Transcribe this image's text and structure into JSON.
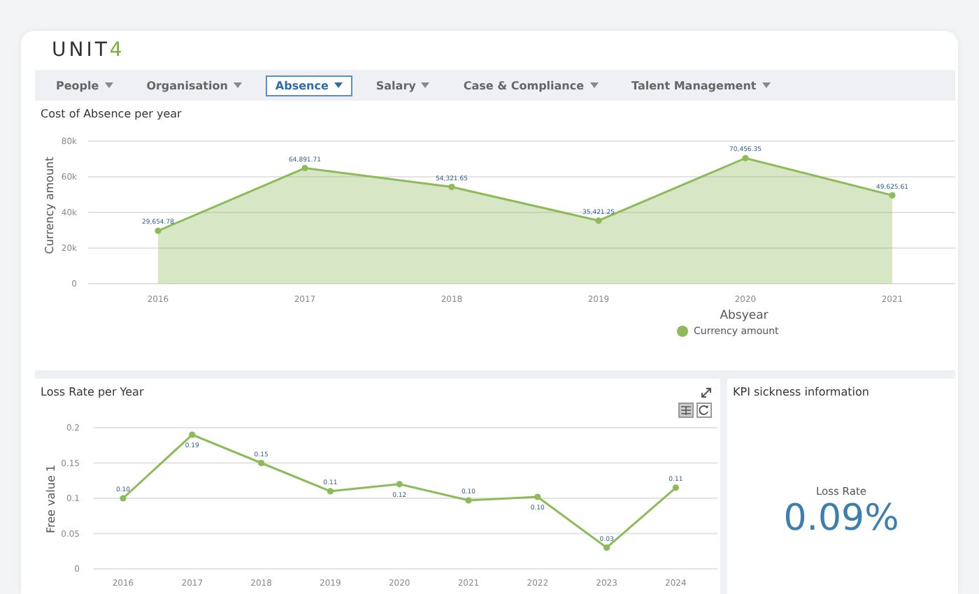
{
  "logo": {
    "text": "UNIT",
    "accent": "4"
  },
  "nav": [
    {
      "label": "People",
      "selected": false
    },
    {
      "label": "Organisation",
      "selected": false
    },
    {
      "label": "Absence",
      "selected": true
    },
    {
      "label": "Salary",
      "selected": false
    },
    {
      "label": "Case & Compliance",
      "selected": false
    },
    {
      "label": "Talent Management",
      "selected": false
    }
  ],
  "cost_panel": {
    "title": "Cost of Absence per year",
    "chart_data": {
      "type": "area",
      "xlabel": "Absyear",
      "ylabel": "Currency amount",
      "categories": [
        "2016",
        "2017",
        "2018",
        "2019",
        "2020",
        "2021"
      ],
      "series": [
        {
          "name": "Currency amount",
          "color": "#8dbb5a",
          "marker": true,
          "values": [
            29700,
            64900,
            54300,
            35400,
            70500,
            49600
          ]
        }
      ],
      "grid": true,
      "value_labels": [
        "29,654.78",
        "64,891.71",
        "54,321.65",
        "35,421.25",
        "70,456.35",
        "49,625.61"
      ],
      "ylim": [
        0,
        80000
      ],
      "yticks": [
        {
          "value": 0,
          "label": "0"
        },
        {
          "value": 20000,
          "label": "20k"
        },
        {
          "value": 40000,
          "label": "40k"
        },
        {
          "value": 60000,
          "label": "60k"
        },
        {
          "value": 80000,
          "label": "80k"
        }
      ]
    }
  },
  "loss_panel": {
    "title": "Loss Rate per Year",
    "chart_data": {
      "type": "line",
      "grid": true,
      "categories": [
        "2016",
        "2017",
        "2018",
        "2019",
        "2020",
        "2021",
        "2022",
        "2023",
        "2024"
      ],
      "series": [
        {
          "name": "Free value 1",
          "color": "#8dbb5a",
          "marker": true,
          "values": [
            0.1,
            0.19,
            0.15,
            0.11,
            0.12,
            0.097,
            0.102,
            0.03,
            0.115
          ]
        }
      ],
      "value_labels": [
        "0.10",
        "0.19",
        "0.15",
        "0.11",
        "0.12",
        "0.10",
        "0.10",
        "0.03",
        "0.11"
      ],
      "ylim": [
        0,
        0.2
      ],
      "yticks": [
        {
          "value": 0,
          "label": "0"
        },
        {
          "value": 0.05,
          "label": "0.05"
        },
        {
          "value": 0.1,
          "label": "0.1"
        },
        {
          "value": 0.15,
          "label": "0.15"
        },
        {
          "value": 0.2,
          "label": "0.2"
        }
      ]
    }
  },
  "kpi_panel": {
    "title": "KPI sickness information",
    "label": "Loss Rate",
    "value": "0.09%"
  }
}
